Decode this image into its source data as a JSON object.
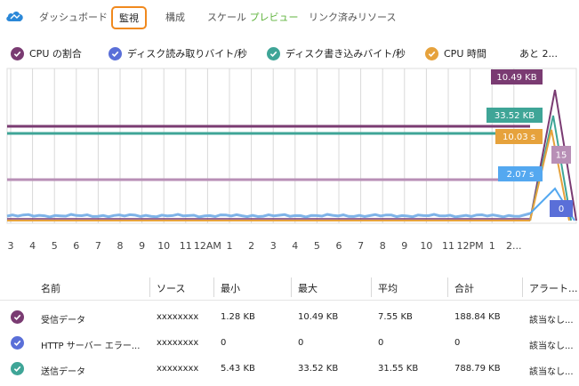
{
  "tabs": [
    {
      "label": "ダッシュボード",
      "active": false
    },
    {
      "label": "監視",
      "active": true
    },
    {
      "label": "構成",
      "active": false
    },
    {
      "label": "スケール",
      "preview": "プレビュー",
      "active": false
    },
    {
      "label": "リンク済みリソース",
      "active": false
    }
  ],
  "colors": {
    "purple": "#7a3b72",
    "blue": "#5a6fd8",
    "teal": "#3fa597",
    "orange": "#e6a23c",
    "lavender": "#b88fb6",
    "lightblue": "#54a8f0",
    "lightblue_line": "#7eb3e8",
    "active_tab": "#f0891e"
  },
  "legend": {
    "items": [
      {
        "label": "CPU の割合",
        "color": "#7a3b72"
      },
      {
        "label": "ディスク読み取りバイト/秒",
        "color": "#5a6fd8"
      },
      {
        "label": "ディスク書き込みバイト/秒",
        "color": "#3fa597"
      },
      {
        "label": "CPU 時間",
        "color": "#e6a23c"
      }
    ],
    "more": "あと 2..."
  },
  "chart_data": {
    "type": "line",
    "x_labels": [
      "3",
      "4",
      "5",
      "6",
      "7",
      "8",
      "9",
      "10",
      "11",
      "12AM",
      "1",
      "2",
      "3",
      "4",
      "5",
      "6",
      "7",
      "8",
      "9",
      "10",
      "11",
      "12PM",
      "1",
      "2..."
    ],
    "value_labels": [
      {
        "text": "10.49 KB",
        "color": "#7a3b72"
      },
      {
        "text": "33.52 KB",
        "color": "#3fa597"
      },
      {
        "text": "10.03 s",
        "color": "#e6a23c"
      },
      {
        "text": "15",
        "color": "#b88fb6"
      },
      {
        "text": "2.07 s",
        "color": "#54a8f0"
      },
      {
        "text": "0",
        "color": "#5a6fd8"
      }
    ]
  },
  "table": {
    "headers": [
      "名前",
      "ソース",
      "最小",
      "最大",
      "平均",
      "合計",
      "アラート..."
    ],
    "rows": [
      {
        "color": "#7a3b72",
        "name": "受信データ",
        "source": "xxxxxxxx",
        "min": "1.28 KB",
        "max": "10.49 KB",
        "avg": "7.55 KB",
        "total": "188.84 KB",
        "alert": "該当なし..."
      },
      {
        "color": "#5a6fd8",
        "name": "HTTP サーバー エラー...",
        "source": "xxxxxxxx",
        "min": "0",
        "max": "0",
        "avg": "0",
        "total": "0",
        "alert": "該当なし..."
      },
      {
        "color": "#3fa597",
        "name": "送信データ",
        "source": "xxxxxxxx",
        "min": "5.43 KB",
        "max": "33.52 KB",
        "avg": "31.55 KB",
        "total": "788.79 KB",
        "alert": "該当なし..."
      }
    ]
  }
}
